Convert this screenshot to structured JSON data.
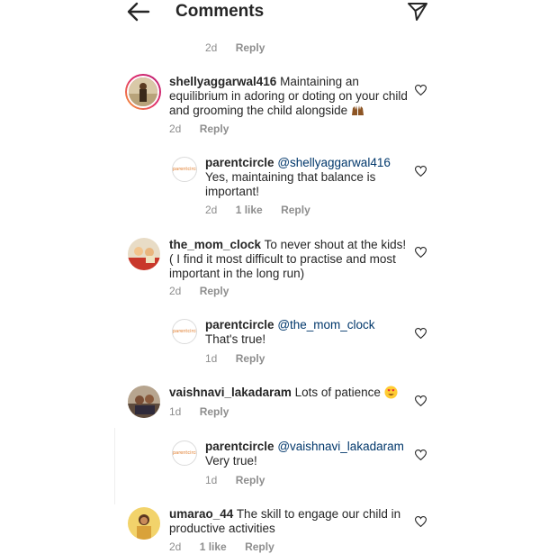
{
  "header": {
    "title": "Comments",
    "back_icon": "arrow-left-icon",
    "send_icon": "send-icon"
  },
  "top_meta": {
    "time": "2d",
    "reply": "Reply"
  },
  "comments": [
    {
      "username": "shellyaggarwal416",
      "text": "Maintaining an equilibrium in adoring or doting on your child and grooming the child alongside",
      "emoji": "raised-hands-emoji",
      "time": "2d",
      "likes": "",
      "reply": "Reply"
    },
    {
      "username": "parentcircle",
      "mention": "@shellyaggarwal416",
      "text": "Yes, maintaining that balance is important!",
      "time": "2d",
      "likes": "1 like",
      "reply": "Reply"
    },
    {
      "username": "the_mom_clock",
      "text": "To never shout at the kids! ( I find it most difficult to practise and most important in the long run)",
      "time": "2d",
      "likes": "",
      "reply": "Reply"
    },
    {
      "username": "parentcircle",
      "mention": "@the_mom_clock",
      "text": "That's true!",
      "time": "1d",
      "likes": "",
      "reply": "Reply"
    },
    {
      "username": "vaishnavi_lakadaram",
      "text": "Lots of patience",
      "emoji": "heart-eyes-emoji",
      "time": "1d",
      "likes": "",
      "reply": "Reply"
    },
    {
      "username": "parentcircle",
      "mention": "@vaishnavi_lakadaram",
      "text": "Very true!",
      "time": "1d",
      "likes": "",
      "reply": "Reply"
    },
    {
      "username": "umarao_44",
      "text": "The skill to engage our child in productive activities",
      "time": "2d",
      "likes": "1 like",
      "reply": "Reply"
    }
  ],
  "colors": {
    "accent_mention": "#00376b",
    "meta_gray": "#8e8e8e",
    "text": "#262626"
  },
  "parentcircle_logo_text": "parentcircle"
}
